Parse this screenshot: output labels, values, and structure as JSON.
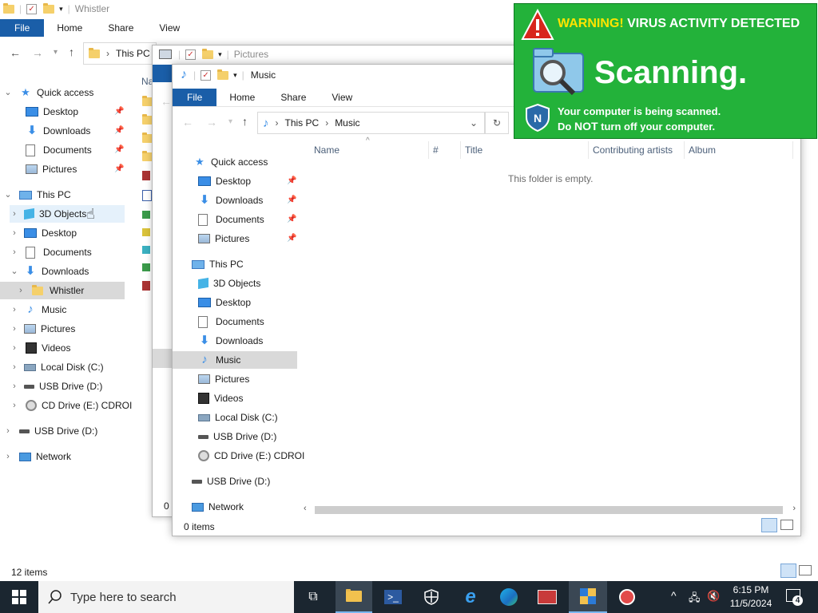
{
  "back_window": {
    "title": "Whistler",
    "ribbon": {
      "file": "File",
      "home": "Home",
      "share": "Share",
      "view": "View"
    },
    "address": {
      "crumb": "This PC"
    },
    "col_partial": "Na",
    "status": "12 items",
    "nav": {
      "quick_access": "Quick access",
      "desktop": "Desktop",
      "downloads": "Downloads",
      "documents": "Documents",
      "pictures": "Pictures",
      "this_pc": "This PC",
      "objects3d": "3D Objects",
      "desktop2": "Desktop",
      "documents2": "Documents",
      "downloads2": "Downloads",
      "whistler": "Whistler",
      "music": "Music",
      "pictures2": "Pictures",
      "videos": "Videos",
      "local_disk": "Local Disk (C:)",
      "usb": "USB Drive (D:)",
      "cd": "CD Drive (E:) CDROI",
      "usb2": "USB Drive (D:)",
      "network": "Network"
    }
  },
  "mid_window": {
    "title": "Pictures",
    "status_partial": "0 i"
  },
  "front_window": {
    "title": "Music",
    "ribbon": {
      "file": "File",
      "home": "Home",
      "share": "Share",
      "view": "View"
    },
    "address": {
      "crumb1": "This PC",
      "crumb2": "Music"
    },
    "columns": {
      "name": "Name",
      "num": "#",
      "title": "Title",
      "artists": "Contributing artists",
      "album": "Album"
    },
    "empty_message": "This folder is empty.",
    "status": "0 items",
    "nav": {
      "quick_access": "Quick access",
      "desktop": "Desktop",
      "downloads": "Downloads",
      "documents": "Documents",
      "pictures": "Pictures",
      "this_pc": "This PC",
      "objects3d": "3D Objects",
      "desktop2": "Desktop",
      "documents2": "Documents",
      "downloads2": "Downloads",
      "music": "Music",
      "pictures2": "Pictures",
      "videos": "Videos",
      "local_disk": "Local Disk (C:)",
      "usb": "USB Drive (D:)",
      "cd": "CD Drive (E:) CDROI",
      "usb2": "USB Drive (D:)",
      "network": "Network"
    }
  },
  "warning_popup": {
    "warning_word": "WARNING!",
    "headline": "VIRUS ACTIVITY DETECTED",
    "scanning": "Scanning.",
    "line1": "Your computer is being scanned.",
    "line2_pre": "Do",
    "line2_not": "NOT",
    "line2_post": "turn off your computer.",
    "colors": {
      "background": "#23b23a",
      "warning_word": "#ffe400",
      "text": "#ffffff"
    }
  },
  "taskbar": {
    "search_placeholder": "Type here to search",
    "time": "6:15 PM",
    "date": "11/5/2024",
    "notification_count": "4"
  }
}
